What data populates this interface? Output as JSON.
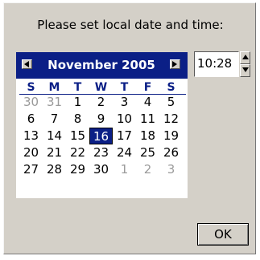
{
  "dialog": {
    "prompt": "Please set local date and time:",
    "ok_label": "OK"
  },
  "calendar": {
    "month_title": "November 2005",
    "days_of_week": [
      "S",
      "M",
      "T",
      "W",
      "T",
      "F",
      "S"
    ],
    "weeks": [
      [
        "30",
        "31",
        "1",
        "2",
        "3",
        "4",
        "5"
      ],
      [
        "6",
        "7",
        "8",
        "9",
        "10",
        "11",
        "12"
      ],
      [
        "13",
        "14",
        "15",
        "16",
        "17",
        "18",
        "19"
      ],
      [
        "20",
        "21",
        "22",
        "23",
        "24",
        "25",
        "26"
      ],
      [
        "27",
        "28",
        "29",
        "30",
        "1",
        "2",
        "3"
      ]
    ],
    "selected_day": "16",
    "colors": {
      "header_bg": "#0b1f86",
      "selected_bg": "#0b1f86",
      "muted_text": "#9a9a9a"
    },
    "icons": {
      "prev": "triangle-left-icon",
      "next": "triangle-right-icon"
    }
  },
  "time": {
    "value": "10:28",
    "icons": {
      "up": "spin-up-icon",
      "down": "spin-down-icon"
    }
  }
}
